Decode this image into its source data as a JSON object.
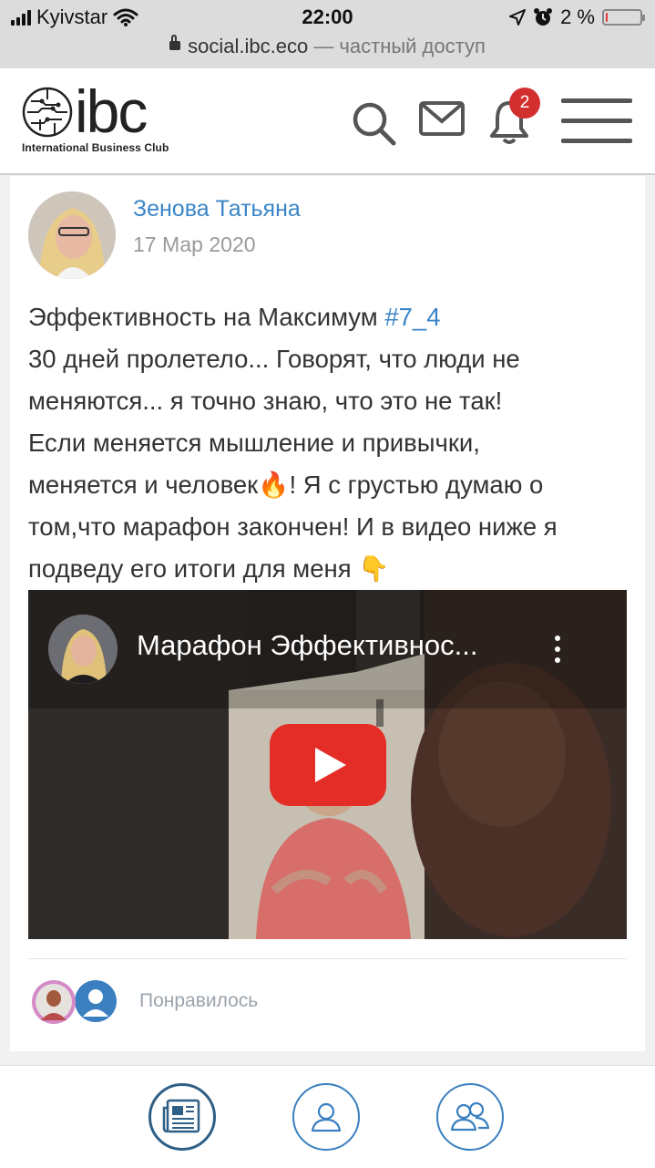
{
  "status_bar": {
    "carrier": "Kyivstar",
    "time": "22:00",
    "battery_text": "2 %",
    "battery_level": 0.02
  },
  "url_bar": {
    "domain": "social.ibc.eco",
    "access": "— частный доступ"
  },
  "header": {
    "logo_subtitle": "International Business Club",
    "notification_count": "2"
  },
  "post": {
    "author": "Зенова Татьяна",
    "date": "17 Мар 2020",
    "text_lines": [
      {
        "text": "Эффективность на Максимум ",
        "hashtag": "#7_4"
      },
      {
        "text": "30 дней пролетело...  Говорят, что люди не"
      },
      {
        "text": "меняются...  я точно знаю, что это не так!"
      },
      {
        "text": "Если меняется мышление и привычки,"
      },
      {
        "text": "меняется и человек🔥! Я с грустью думаю о"
      },
      {
        "text": "том,что марафон закончен! И в видео ниже я"
      },
      {
        "text": "подведу его итоги для меня 👇"
      }
    ],
    "video": {
      "title": "Марафон Эффективнос..."
    },
    "likes_label": "Понравилось"
  },
  "colors": {
    "link_blue": "#3a85c8",
    "nav_blue": "#3a7fc0",
    "youtube_red": "#e52d27",
    "badge_red": "#d32f2f"
  },
  "bottom_nav": [
    {
      "icon": "newspaper-icon"
    },
    {
      "icon": "user-icon"
    },
    {
      "icon": "users-icon"
    }
  ]
}
